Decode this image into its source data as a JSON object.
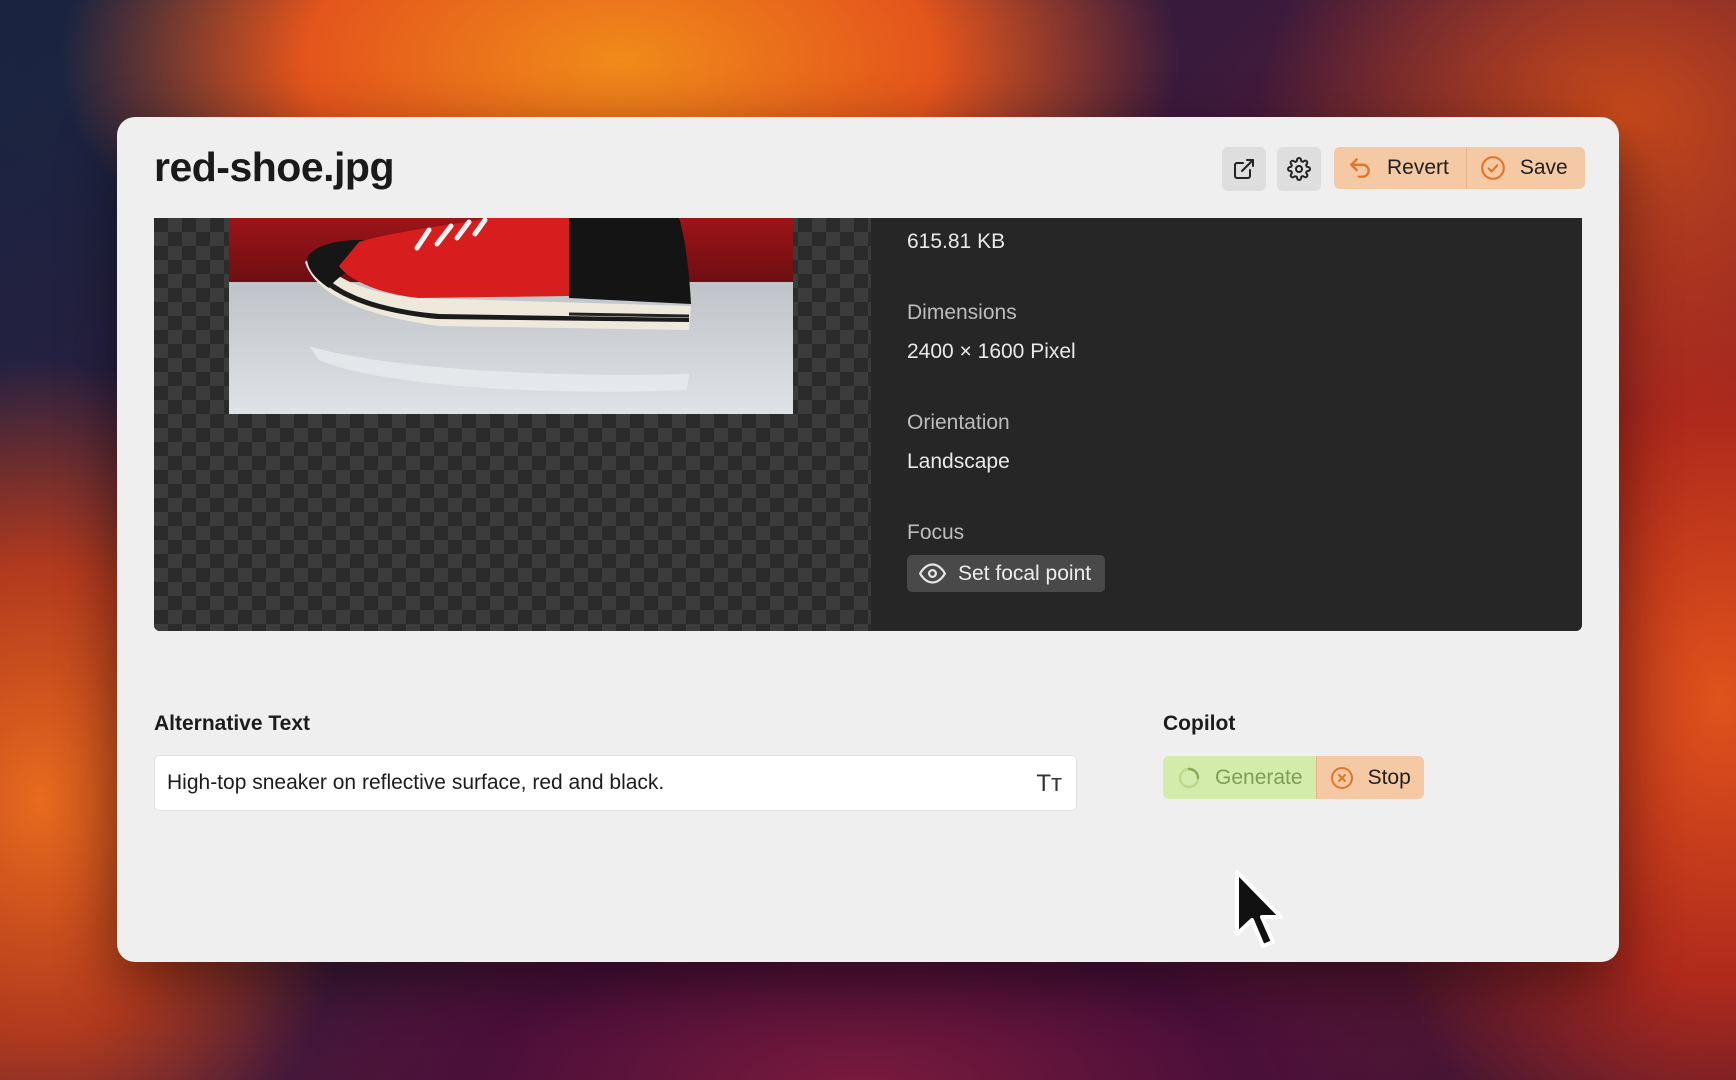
{
  "window": {
    "title": "red-shoe.jpg"
  },
  "toolbar": {
    "open_external_icon": "external-link-icon",
    "settings_icon": "gear-icon",
    "revert_label": "Revert",
    "save_label": "Save"
  },
  "metadata": {
    "file_size": "615.81 KB",
    "dimensions_label": "Dimensions",
    "dimensions_value": "2400 × 1600 Pixel",
    "orientation_label": "Orientation",
    "orientation_value": "Landscape",
    "focus_label": "Focus",
    "focal_point_button": "Set focal point"
  },
  "alt_text": {
    "label": "Alternative Text",
    "value": "High-top sneaker on reflective surface, red and black.",
    "format_icon_text": "Tт"
  },
  "copilot": {
    "label": "Copilot",
    "generate_label": "Generate",
    "stop_label": "Stop"
  },
  "colors": {
    "accent_orange": "#f5c9a4",
    "accent_green": "#d4ecab",
    "orange_icon": "#e0762a"
  }
}
